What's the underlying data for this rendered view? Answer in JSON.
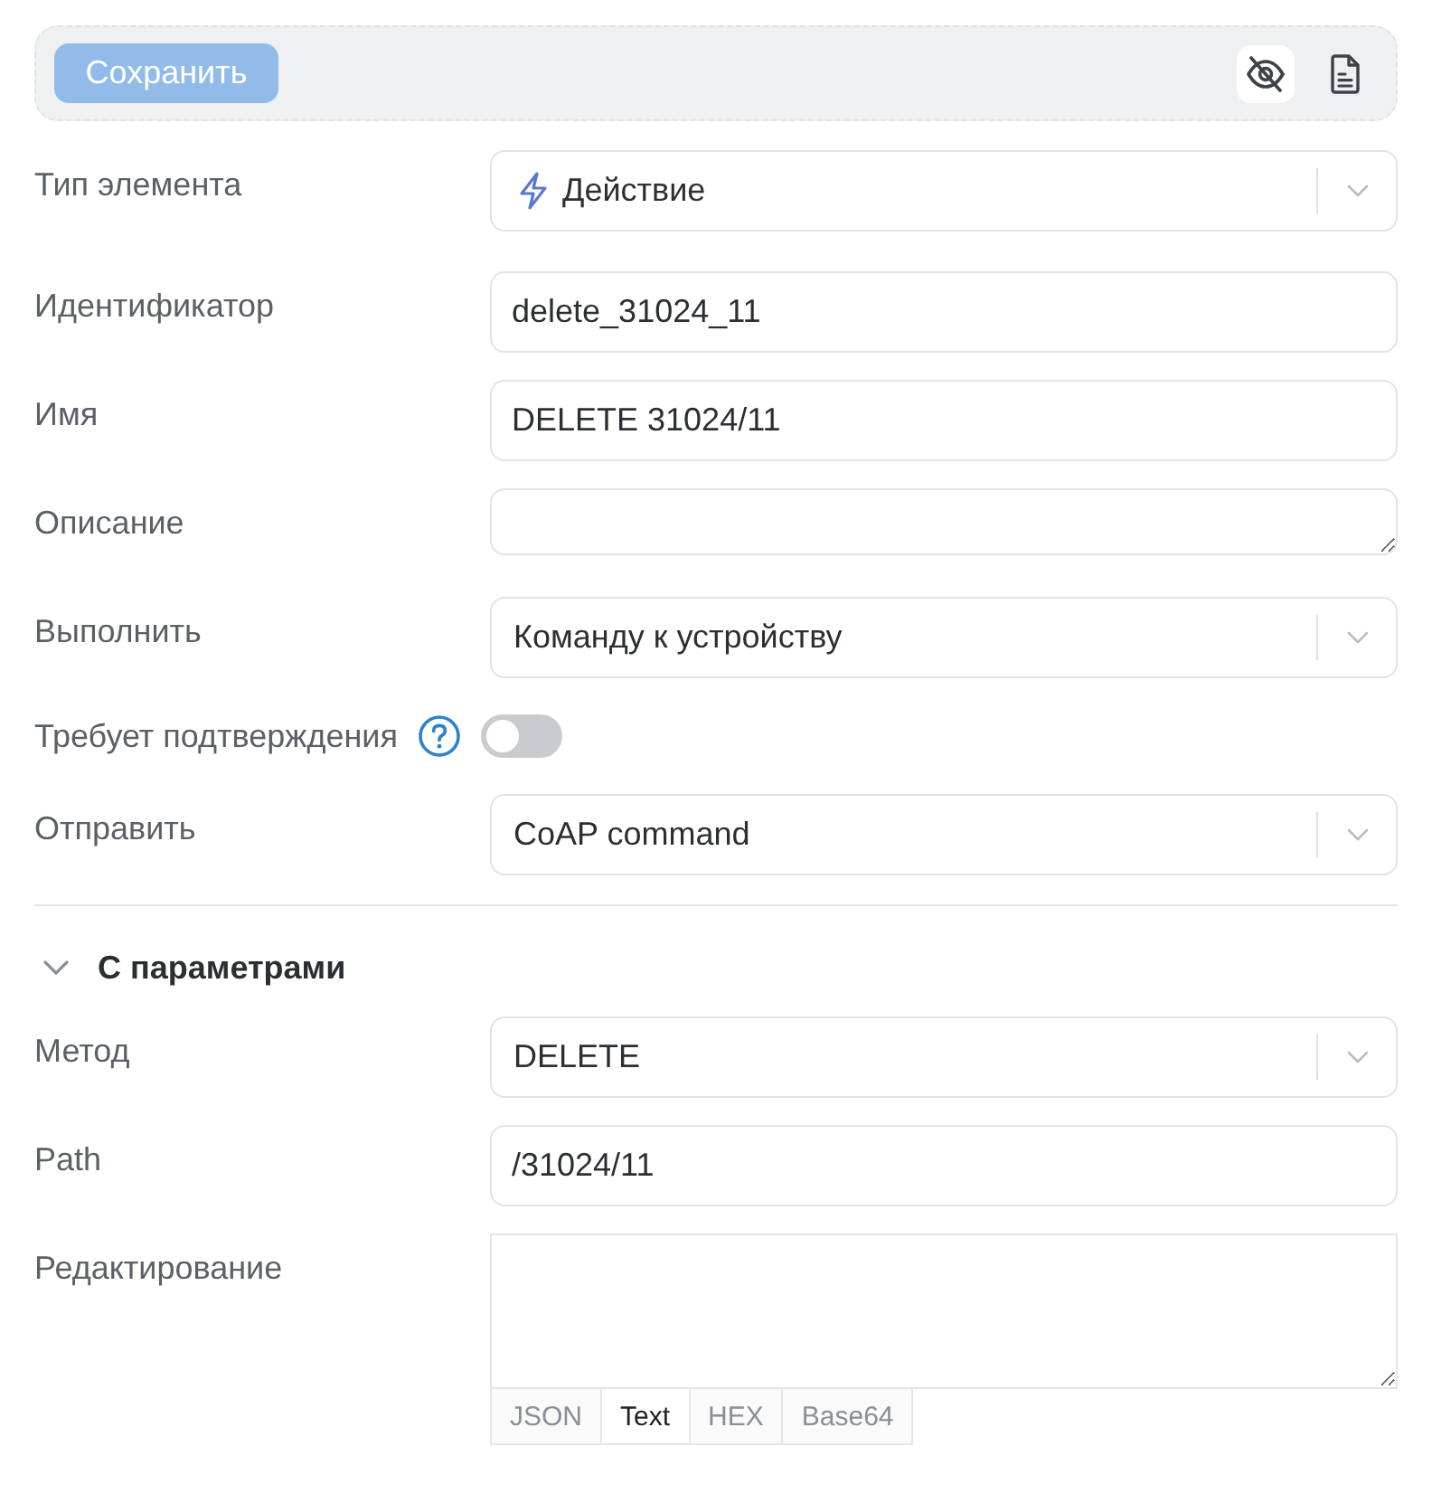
{
  "toolbar": {
    "save_button": {
      "label": "Сохранить",
      "disabled": true
    },
    "tools": [
      {
        "kind": "visibility",
        "selected": true
      },
      {
        "kind": "document",
        "selected": false
      }
    ]
  },
  "fields": [
    {
      "kind": "type_select",
      "label": "Тип элемента",
      "value": "Действие"
    },
    {
      "kind": "input",
      "label": "Идентификатор",
      "value": "delete_31024_11"
    },
    {
      "kind": "input",
      "label": "Имя",
      "value": "DELETE 31024/11"
    },
    {
      "kind": "textarea",
      "label": "Описание"
    },
    {
      "kind": "select",
      "label": "Выполнить",
      "value": "Команду к устройству"
    },
    {
      "kind": "toggle",
      "label": "Требует подтверждения",
      "on": false
    },
    {
      "kind": "select",
      "label": "Отправить",
      "value": "CoAP command"
    }
  ],
  "section": {
    "title": "С параметрами",
    "expanded": true,
    "fields": [
      {
        "kind": "select",
        "label": "Метод",
        "value": "DELETE"
      },
      {
        "kind": "input",
        "label": "Path",
        "value": "/31024/11"
      },
      {
        "kind": "editor",
        "label": "Редактирование",
        "formats": [
          {
            "label": "JSON",
            "selected": false
          },
          {
            "label": "Text",
            "selected": true
          },
          {
            "label": "HEX",
            "selected": false
          },
          {
            "label": "Base64",
            "selected": false
          }
        ]
      }
    ]
  }
}
